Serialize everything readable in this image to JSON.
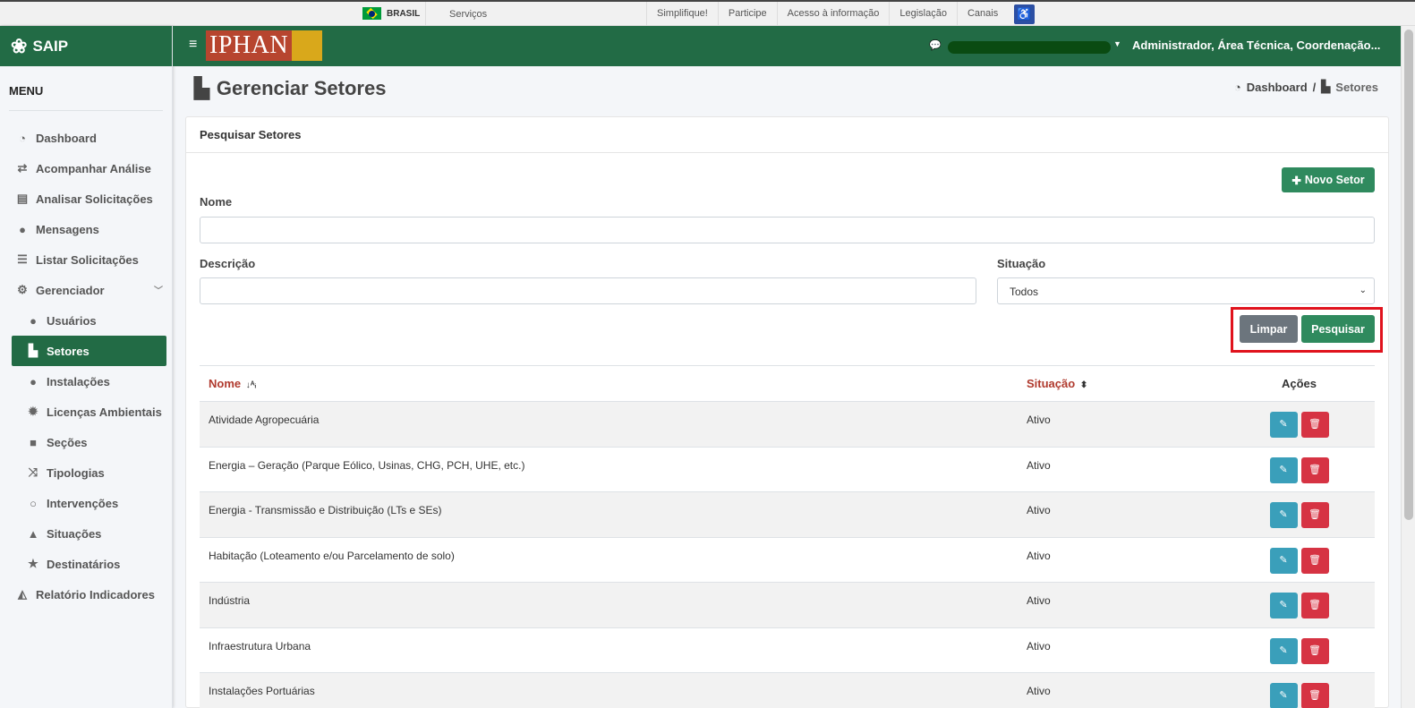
{
  "govbar": {
    "country": "BRASIL",
    "services": "Serviços",
    "links": [
      "Simplifique!",
      "Participe",
      "Acesso à informação",
      "Legislação",
      "Canais"
    ]
  },
  "app": {
    "brand": "SAIP",
    "logo_text": "IPHAN",
    "user": "Administrador, Área Técnica, Coordenação..."
  },
  "sidebar": {
    "menu_title": "MENU",
    "items": [
      {
        "label": "Dashboard",
        "icon": "dashboard-icon",
        "glyph": "◔"
      },
      {
        "label": "Acompanhar Análise",
        "icon": "exchange-icon",
        "glyph": "⇄"
      },
      {
        "label": "Analisar Solicitações",
        "icon": "book-icon",
        "glyph": "▤"
      },
      {
        "label": "Mensagens",
        "icon": "comments-icon",
        "glyph": "●"
      },
      {
        "label": "Listar Solicitações",
        "icon": "list-icon",
        "glyph": "☰"
      },
      {
        "label": "Gerenciador",
        "icon": "cogs-icon",
        "glyph": "⚙"
      }
    ],
    "subitems": [
      {
        "label": "Usuários",
        "icon": "users-icon",
        "glyph": "●"
      },
      {
        "label": "Setores",
        "icon": "industry-icon",
        "glyph": "▙"
      },
      {
        "label": "Instalações",
        "icon": "circle-icon",
        "glyph": "●"
      },
      {
        "label": "Licenças Ambientais",
        "icon": "certificate-icon",
        "glyph": "✹"
      },
      {
        "label": "Seções",
        "icon": "square-icon",
        "glyph": "■"
      },
      {
        "label": "Tipologias",
        "icon": "random-icon",
        "glyph": "⤨"
      },
      {
        "label": "Intervenções",
        "icon": "circle-notch-icon",
        "glyph": "○"
      },
      {
        "label": "Situações",
        "icon": "bell-icon",
        "glyph": "▲"
      },
      {
        "label": "Destinatários",
        "icon": "star-icon",
        "glyph": "★"
      }
    ],
    "footer_item": {
      "label": "Relatório Indicadores",
      "icon": "area-chart-icon",
      "glyph": "◭"
    }
  },
  "page": {
    "title": "Gerenciar Setores",
    "breadcrumb": {
      "home": "Dashboard",
      "sep": "/",
      "current": "Setores"
    }
  },
  "search": {
    "card_title": "Pesquisar Setores",
    "new_button": "Novo Setor",
    "nome_label": "Nome",
    "nome_value": "",
    "descricao_label": "Descrição",
    "descricao_value": "",
    "situacao_label": "Situação",
    "situacao_value": "Todos",
    "clear_button": "Limpar",
    "search_button": "Pesquisar"
  },
  "table": {
    "headers": {
      "nome": "Nome",
      "situacao": "Situação",
      "acoes": "Ações"
    },
    "rows": [
      {
        "nome": "Atividade Agropecuária",
        "situacao": "Ativo"
      },
      {
        "nome": "Energia – Geração (Parque Eólico, Usinas, CHG, PCH, UHE, etc.)",
        "situacao": "Ativo"
      },
      {
        "nome": "Energia - Transmissão e Distribuição (LTs e SEs)",
        "situacao": "Ativo"
      },
      {
        "nome": "Habitação (Loteamento e/ou Parcelamento de solo)",
        "situacao": "Ativo"
      },
      {
        "nome": "Indústria",
        "situacao": "Ativo"
      },
      {
        "nome": "Infraestrutura Urbana",
        "situacao": "Ativo"
      },
      {
        "nome": "Instalações Portuárias",
        "situacao": "Ativo"
      }
    ]
  },
  "colors": {
    "primary": "#226b45",
    "success": "#2f8a5e",
    "secondary": "#6c757d",
    "info": "#3a9fba",
    "danger": "#d63343",
    "highlight": "#e0131d"
  }
}
